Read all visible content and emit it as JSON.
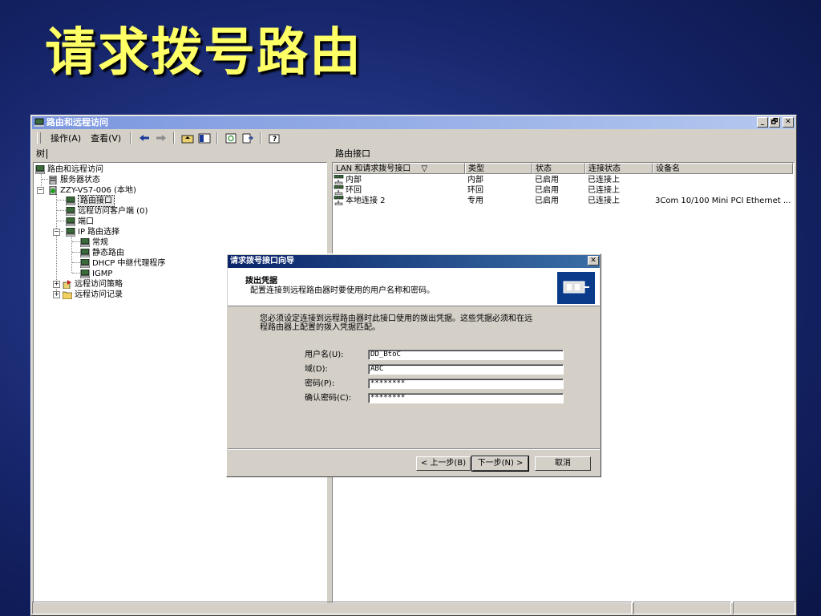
{
  "slide": {
    "title": "请求拨号路由"
  },
  "window": {
    "title": "路由和远程访问",
    "controls": [
      "_",
      "🗗",
      "✕"
    ],
    "menu": [
      "操作(A)",
      "查看(V)"
    ]
  },
  "left_pane": {
    "header": "树",
    "tree": [
      {
        "label": "路由和远程访问"
      },
      {
        "label": "服务器状态"
      },
      {
        "label": "ZZY-VS7-006 (本地)"
      },
      {
        "label": "路由接口"
      },
      {
        "label": "远程访问客户端 (0)"
      },
      {
        "label": "端口"
      },
      {
        "label": "IP 路由选择"
      },
      {
        "label": "常规"
      },
      {
        "label": "静态路由"
      },
      {
        "label": "DHCP 中继代理程序"
      },
      {
        "label": "IGMP"
      },
      {
        "label": "远程访问策略"
      },
      {
        "label": "远程访问记录"
      }
    ]
  },
  "right_pane": {
    "header": "路由接口",
    "columns": [
      "LAN 和请求拨号接口",
      "类型",
      "状态",
      "连接状态",
      "设备名"
    ],
    "sort_indicator": "▽",
    "rows": [
      [
        "内部",
        "内部",
        "已启用",
        "已连接上",
        ""
      ],
      [
        "环回",
        "环回",
        "已启用",
        "已连接上",
        ""
      ],
      [
        "本地连接 2",
        "专用",
        "已启用",
        "已连接上",
        "3Com 10/100 Mini PCI Ethernet ..."
      ]
    ]
  },
  "dialog": {
    "title": "请求拨号接口向导",
    "close": "✕",
    "heading": "拨出凭据",
    "subheading": "配置连接到远程路由器时要使用的用户名称和密码。",
    "body_line1": "您必须设定连接到远程路由器时此接口使用的拨出凭据。这些凭据必须和在远",
    "body_line2": "程路由器上配置的拨入凭据匹配。",
    "fields": [
      {
        "label": "用户名(U):",
        "value": "DD_BtoC"
      },
      {
        "label": "域(D):",
        "value": "ABC"
      },
      {
        "label": "密码(P):",
        "value": "********"
      },
      {
        "label": "确认密码(C):",
        "value": "********"
      }
    ],
    "buttons": {
      "back": "< 上一步(B)",
      "next": "下一步(N) >",
      "cancel": "取消"
    }
  }
}
